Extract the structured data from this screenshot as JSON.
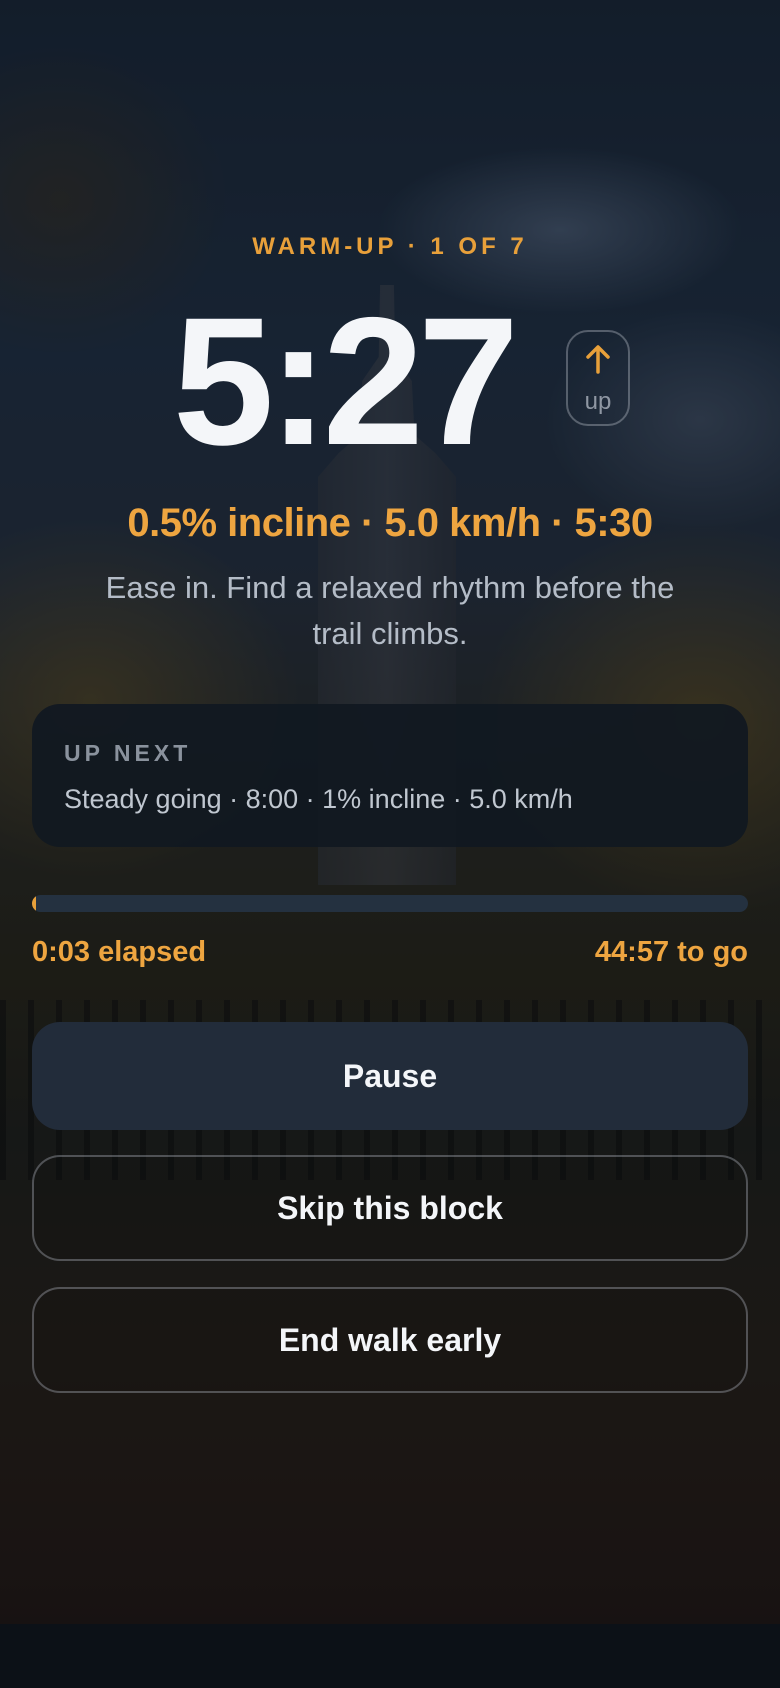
{
  "session": {
    "phase_label": "WARM-UP · 1 OF 7",
    "block_countdown": "5:27",
    "incline_direction": {
      "icon": "arrow-up-icon",
      "label": "up"
    },
    "target": "0.5% incline · 5.0 km/h · 5:30",
    "coaching_cue": "Ease in. Find a relaxed rhythm before the trail climbs."
  },
  "up_next": {
    "title": "UP NEXT",
    "details": "Steady going · 8:00 · 1% incline · 5.0 km/h"
  },
  "progress": {
    "fraction": 0.001,
    "elapsed_text": "0:03 elapsed",
    "remaining_text": "44:57 to go"
  },
  "actions": {
    "pause_label": "Pause",
    "skip_label": "Skip this block",
    "end_label": "End walk early"
  },
  "colors": {
    "accent": "#e8a03a",
    "card": "#111821",
    "primary_button": "#222c3a",
    "text_primary": "#f4f6f9",
    "text_secondary": "#b4bcc7"
  }
}
